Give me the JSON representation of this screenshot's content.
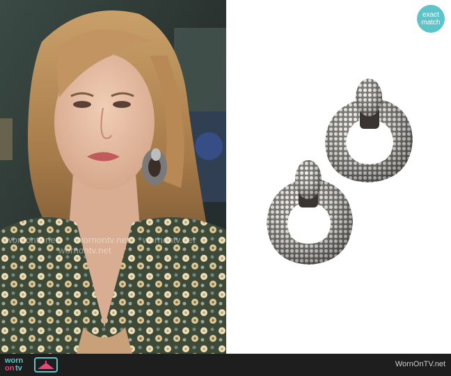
{
  "badge": {
    "line1": "exact",
    "line2": "match"
  },
  "watermarks": [
    "wornontv.net",
    "wornontv.net",
    "wornontv.net",
    "wornontv.net"
  ],
  "footer": {
    "logo": {
      "word1": "worn",
      "word2": "on",
      "word3": "tv"
    },
    "site": "WornOnTV.net"
  },
  "colors": {
    "accent": "#5fc4c9",
    "footer_bg": "#1e1e1e",
    "logo_pink": "#e8457a"
  }
}
